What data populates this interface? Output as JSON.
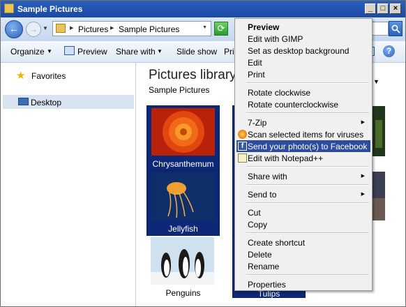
{
  "window": {
    "title": "Sample Pictures"
  },
  "address": {
    "segments": [
      "Pictures",
      "Sample Pictures"
    ]
  },
  "toolbar": {
    "organize": "Organize",
    "preview": "Preview",
    "share_with": "Share with",
    "slide_show": "Slide show",
    "print_partial": "Prin"
  },
  "sidebar": {
    "favorites": "Favorites",
    "desktop": "Desktop"
  },
  "library": {
    "title": "Pictures library",
    "subtitle": "Sample Pictures"
  },
  "files": [
    {
      "name": "Chrysanthemum",
      "selected": true
    },
    {
      "name": "Jellyfish",
      "selected": true
    },
    {
      "name": "Penguins",
      "selected": false
    },
    {
      "name": "Tulips",
      "selected": true
    }
  ],
  "context_menu": {
    "items": [
      {
        "label": "Preview",
        "bold": true
      },
      {
        "label": "Edit with GIMP"
      },
      {
        "label": "Set as desktop background"
      },
      {
        "label": "Edit"
      },
      {
        "label": "Print"
      },
      {
        "label": "Rotate clockwise"
      },
      {
        "label": "Rotate counterclockwise"
      },
      {
        "label": "7-Zip",
        "submenu": true
      },
      {
        "label": "Scan selected items for viruses",
        "icon": "antivirus-icon"
      },
      {
        "label": "Send your photo(s) to Facebook",
        "icon": "facebook-icon",
        "highlighted": true
      },
      {
        "label": "Edit with Notepad++",
        "icon": "notepad-plus-plus-icon"
      },
      {
        "label": "Share with",
        "submenu": true
      },
      {
        "label": "Send to",
        "submenu": true
      },
      {
        "label": "Cut"
      },
      {
        "label": "Copy"
      },
      {
        "label": "Create shortcut"
      },
      {
        "label": "Delete"
      },
      {
        "label": "Rename"
      },
      {
        "label": "Properties"
      }
    ]
  },
  "colors": {
    "selection": "#0d2876",
    "menu_highlight": "#2e4c9d",
    "titlebar": "#1b49a3"
  }
}
